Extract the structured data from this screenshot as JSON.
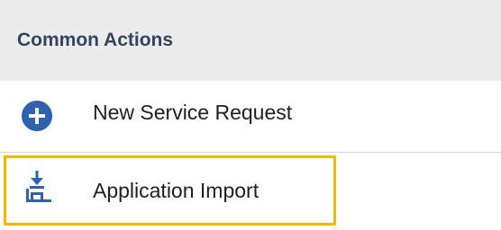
{
  "panel": {
    "title": "Common Actions"
  },
  "actions": [
    {
      "label": "New Service Request",
      "icon": "plus-circle-icon",
      "icon_color": "#2f62ad"
    },
    {
      "label": "Application Import",
      "icon": "import-icon",
      "icon_color": "#2f62ad",
      "highlighted": true
    }
  ],
  "colors": {
    "header_bg": "#ececec",
    "title_text": "#33455e",
    "highlight": "#f5b800",
    "accent": "#2f62ad"
  }
}
